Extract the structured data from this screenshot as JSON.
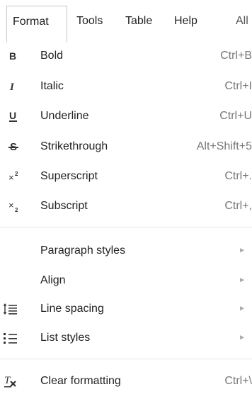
{
  "menubar": {
    "items": [
      {
        "label": "Format"
      },
      {
        "label": "Tools"
      },
      {
        "label": "Table"
      },
      {
        "label": "Help"
      },
      {
        "label": "All"
      }
    ]
  },
  "menu": {
    "bold": {
      "icon": "bold-icon",
      "label": "Bold",
      "shortcut": "Ctrl+B"
    },
    "italic": {
      "icon": "italic-icon",
      "label": "Italic",
      "shortcut": "Ctrl+I"
    },
    "underline": {
      "icon": "underline-icon",
      "label": "Underline",
      "shortcut": "Ctrl+U"
    },
    "strikethrough": {
      "icon": "strikethrough-icon",
      "label": "Strikethrough",
      "shortcut": "Alt+Shift+5"
    },
    "superscript": {
      "icon": "superscript-icon",
      "label": "Superscript",
      "shortcut": "Ctrl+."
    },
    "subscript": {
      "icon": "subscript-icon",
      "label": "Subscript",
      "shortcut": "Ctrl+,"
    },
    "paragraph_styles": {
      "label": "Paragraph styles",
      "arrow": "►"
    },
    "align": {
      "label": "Align",
      "arrow": "►"
    },
    "line_spacing": {
      "icon": "line-spacing-icon",
      "label": "Line spacing",
      "arrow": "►"
    },
    "list_styles": {
      "icon": "list-styles-icon",
      "label": "List styles",
      "arrow": "►"
    },
    "clear_formatting": {
      "icon": "clear-formatting-icon",
      "label": "Clear formatting",
      "shortcut": "Ctrl+\\"
    }
  },
  "colors": {
    "shortcut_text": "#777777",
    "separator": "#e5e5e5",
    "border": "#c6c6c6"
  }
}
